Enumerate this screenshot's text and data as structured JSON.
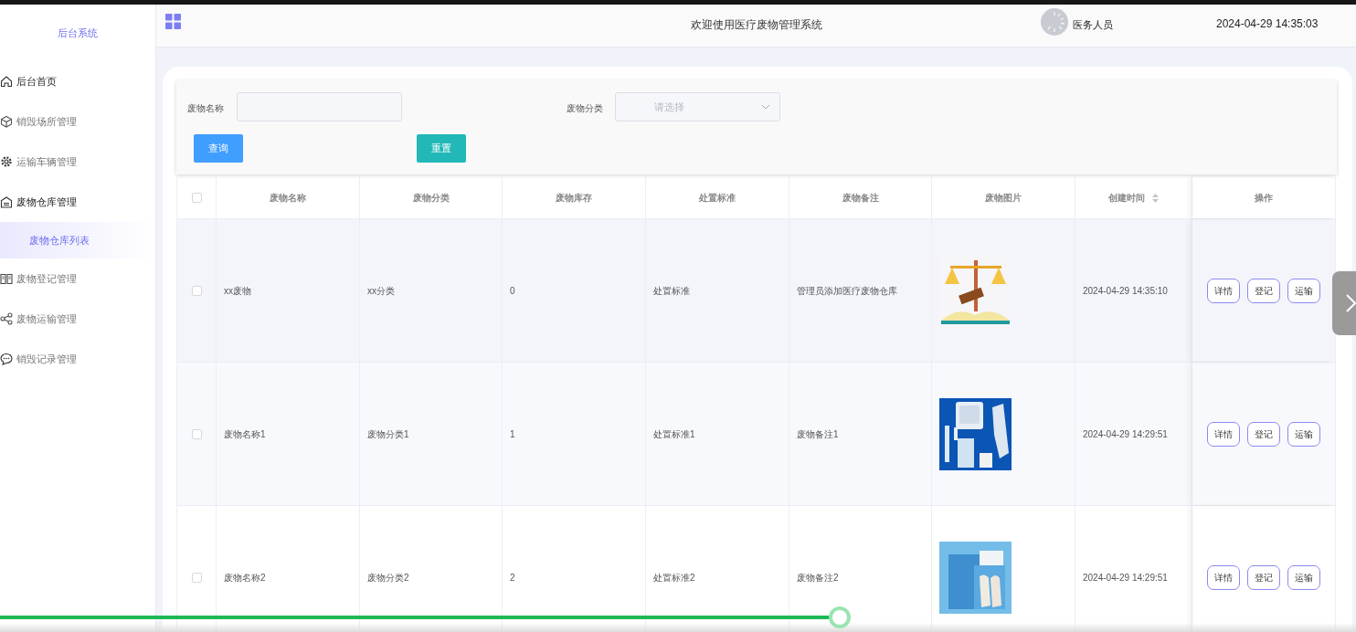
{
  "sidebar": {
    "title": "后台系统",
    "items": [
      {
        "label": "后台首页",
        "kind": "home",
        "expanded": false
      },
      {
        "label": "销毁场所管理",
        "kind": "menu",
        "expanded": false
      },
      {
        "label": "运输车辆管理",
        "kind": "menu",
        "expanded": false
      },
      {
        "label": "废物仓库管理",
        "kind": "menu",
        "expanded": true,
        "children": [
          {
            "label": "废物仓库列表",
            "selected": true
          }
        ]
      },
      {
        "label": "废物登记管理",
        "kind": "menu",
        "expanded": false
      },
      {
        "label": "废物运输管理",
        "kind": "menu",
        "expanded": false
      },
      {
        "label": "销毁记录管理",
        "kind": "menu",
        "expanded": false
      }
    ]
  },
  "header": {
    "title": "欢迎使用医疗废物管理系统",
    "user": "医务人员",
    "datetime": "2024-04-29 14:35:03"
  },
  "search": {
    "fields": [
      {
        "label": "废物名称",
        "kind": "text"
      },
      {
        "label": "废物分类",
        "kind": "select",
        "placeholder": "请选择"
      }
    ],
    "buttons": [
      {
        "label": "查询",
        "kind": "primary"
      },
      {
        "label": "重置",
        "kind": "reset"
      }
    ]
  },
  "table": {
    "header_checked": false,
    "columns": [
      {
        "label": "废物名称"
      },
      {
        "label": "废物分类"
      },
      {
        "label": "废物库存"
      },
      {
        "label": "处置标准"
      },
      {
        "label": "废物备注"
      },
      {
        "label": "废物图片"
      },
      {
        "label": "创建时间",
        "sortable": true
      },
      {
        "label": "操作"
      }
    ],
    "rows": [
      {
        "checked": false,
        "cells": [
          "xx废物",
          "xx分类",
          "0",
          "处置标准",
          "管理员添加医疗废物仓库"
        ],
        "created": "2024-04-29 14:35:10",
        "actions": [
          "详情",
          "登记",
          "运输"
        ]
      },
      {
        "checked": false,
        "cells": [
          "废物名称1",
          "废物分类1",
          "1",
          "处置标准1",
          "废物备注1"
        ],
        "created": "2024-04-29 14:29:51",
        "actions": [
          "详情",
          "登记",
          "运输"
        ]
      },
      {
        "checked": false,
        "cells": [
          "废物名称2",
          "废物分类2",
          "2",
          "处置标准2",
          "废物备注2"
        ],
        "created": "2024-04-29 14:29:51",
        "actions": [
          "详情",
          "登记",
          "运输"
        ]
      }
    ]
  },
  "video_progress": {
    "level": 0.619
  }
}
